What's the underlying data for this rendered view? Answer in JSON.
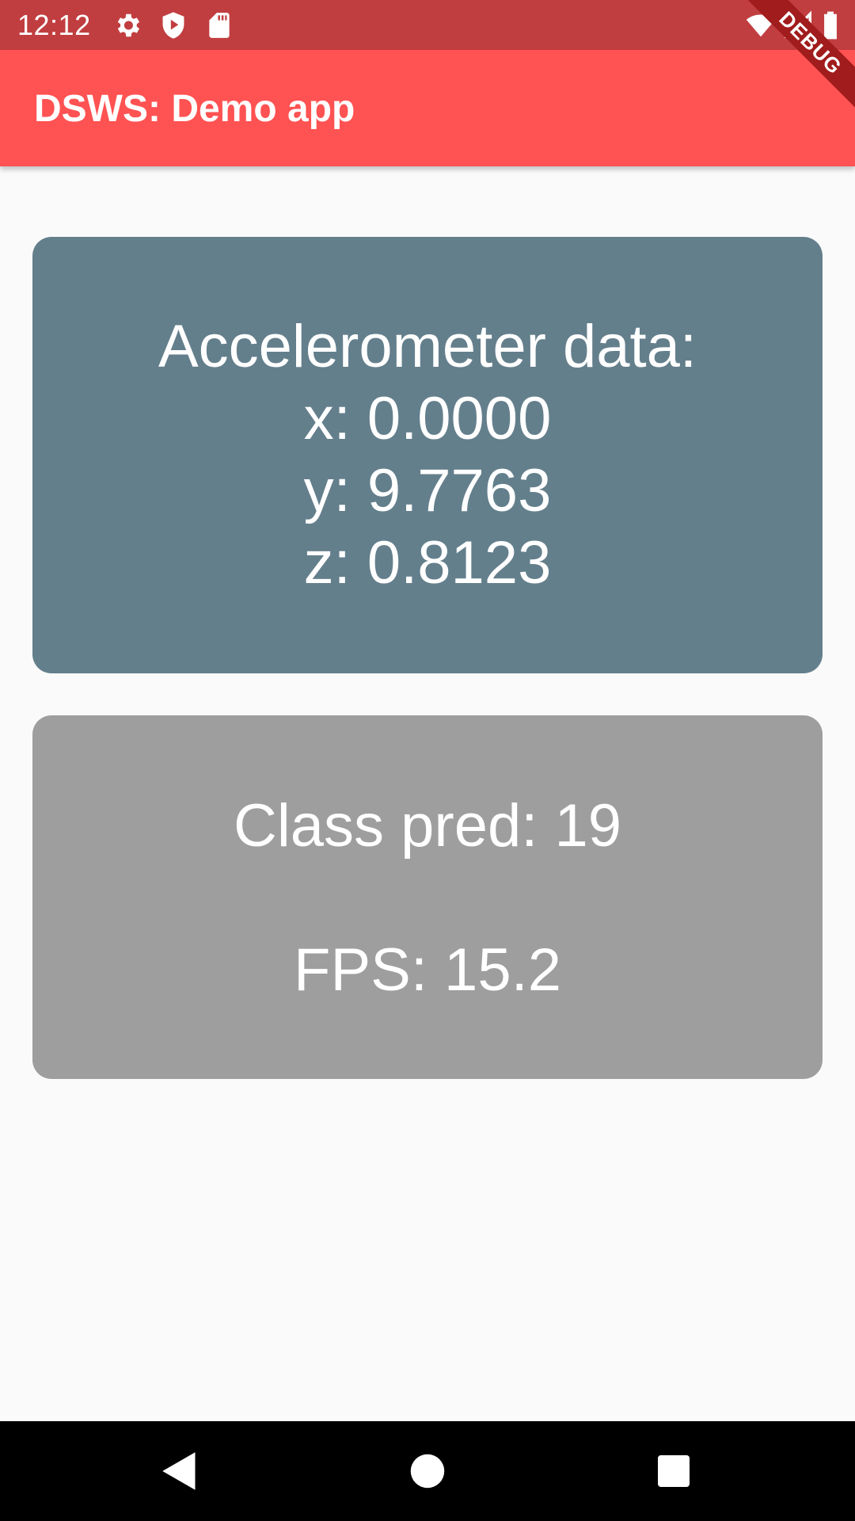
{
  "status_bar": {
    "time": "12:12",
    "icons": [
      "settings-icon",
      "shield-play-icon",
      "sd-card-icon",
      "wifi-icon",
      "signal-icon",
      "battery-icon"
    ],
    "color": "#c13e40"
  },
  "app_bar": {
    "title": "DSWS: Demo app",
    "color": "#ff5252",
    "debug_banner": "DEBUG"
  },
  "accelerometer": {
    "heading": "Accelerometer data:",
    "x": "x: 0.0000",
    "y": "y: 9.7763",
    "z": "z: 0.8123",
    "color": "#647f8c"
  },
  "prediction": {
    "class_pred": "Class pred: 19",
    "fps": "FPS: 15.2",
    "color": "#9e9e9e"
  },
  "nav_bar": {
    "icons": [
      "back-icon",
      "home-icon",
      "recents-icon"
    ]
  }
}
